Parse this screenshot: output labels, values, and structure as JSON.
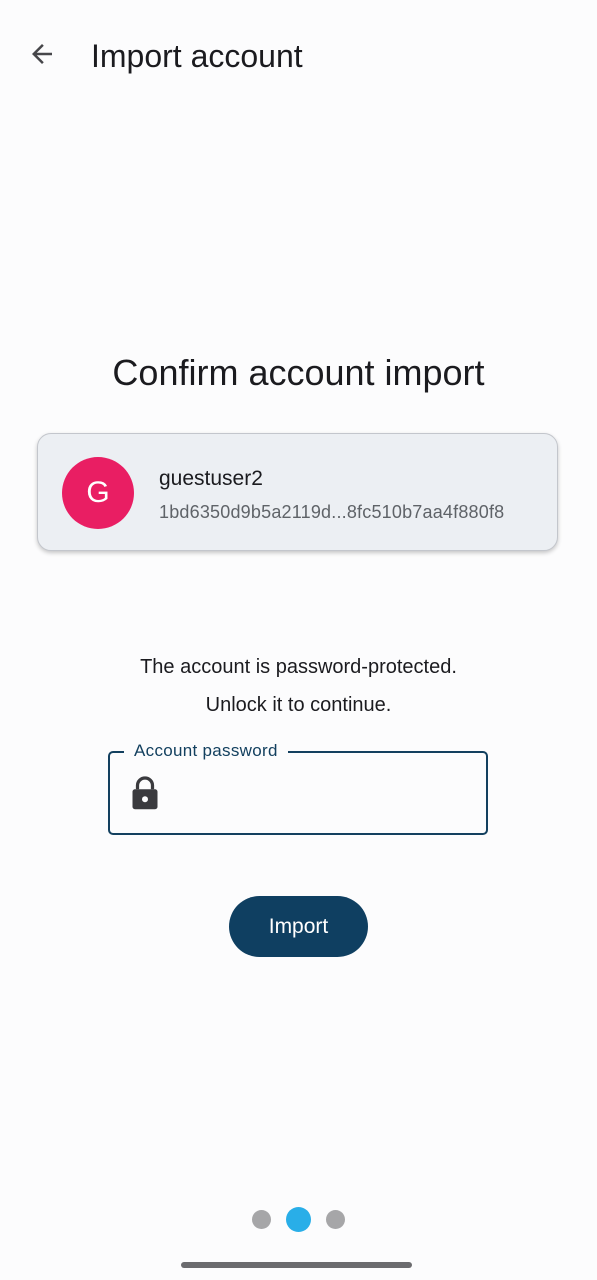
{
  "app_bar": {
    "title": "Import account",
    "back_icon": "arrow-left-icon"
  },
  "heading": "Confirm account import",
  "account": {
    "avatar_letter": "G",
    "avatar_color": "#e91e63",
    "name": "guestuser2",
    "id": "1bd6350d9b5a2119d...8fc510b7aa4f880f8"
  },
  "info": {
    "line1": "The account is password-protected.",
    "line2": "Unlock it to continue."
  },
  "password_field": {
    "label": "Account password",
    "value": "",
    "icon": "lock-icon"
  },
  "import_button": {
    "label": "Import"
  },
  "pager": {
    "total": 3,
    "active_index": 1,
    "active_color": "#29aee8",
    "inactive_color": "#a6a6a8"
  },
  "colors": {
    "primary": "#0f3f61",
    "field_border": "#13405f",
    "card_background": "#eceff3"
  }
}
